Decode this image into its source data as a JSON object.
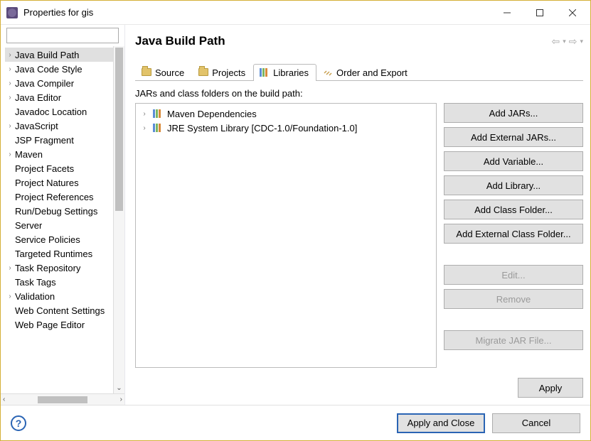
{
  "window": {
    "title": "Properties for gis"
  },
  "sidebar": {
    "filter_value": "",
    "items": [
      {
        "label": "Java Build Path",
        "expandable": true,
        "selected": true
      },
      {
        "label": "Java Code Style",
        "expandable": true
      },
      {
        "label": "Java Compiler",
        "expandable": true
      },
      {
        "label": "Java Editor",
        "expandable": true
      },
      {
        "label": "Javadoc Location",
        "expandable": false
      },
      {
        "label": "JavaScript",
        "expandable": true
      },
      {
        "label": "JSP Fragment",
        "expandable": false
      },
      {
        "label": "Maven",
        "expandable": true
      },
      {
        "label": "Project Facets",
        "expandable": false
      },
      {
        "label": "Project Natures",
        "expandable": false
      },
      {
        "label": "Project References",
        "expandable": false
      },
      {
        "label": "Run/Debug Settings",
        "expandable": false
      },
      {
        "label": "Server",
        "expandable": false
      },
      {
        "label": "Service Policies",
        "expandable": false
      },
      {
        "label": "Targeted Runtimes",
        "expandable": false
      },
      {
        "label": "Task Repository",
        "expandable": true
      },
      {
        "label": "Task Tags",
        "expandable": false
      },
      {
        "label": "Validation",
        "expandable": true
      },
      {
        "label": "Web Content Settings",
        "expandable": false
      },
      {
        "label": "Web Page Editor",
        "expandable": false
      }
    ]
  },
  "main": {
    "title": "Java Build Path",
    "tabs": [
      {
        "label": "Source",
        "icon": "folder-icon"
      },
      {
        "label": "Projects",
        "icon": "folder-icon"
      },
      {
        "label": "Libraries",
        "icon": "library-icon",
        "active": true
      },
      {
        "label": "Order and Export",
        "icon": "order-icon"
      }
    ],
    "desc": "JARs and class folders on the build path:",
    "list": [
      {
        "label": "Maven Dependencies"
      },
      {
        "label": "JRE System Library [CDC-1.0/Foundation-1.0]"
      }
    ],
    "buttons": {
      "add_jars": "Add JARs...",
      "add_external_jars": "Add External JARs...",
      "add_variable": "Add Variable...",
      "add_library": "Add Library...",
      "add_class_folder": "Add Class Folder...",
      "add_external_class_folder": "Add External Class Folder...",
      "edit": "Edit...",
      "remove": "Remove",
      "migrate": "Migrate JAR File..."
    },
    "apply": "Apply"
  },
  "footer": {
    "apply_close": "Apply and Close",
    "cancel": "Cancel"
  }
}
